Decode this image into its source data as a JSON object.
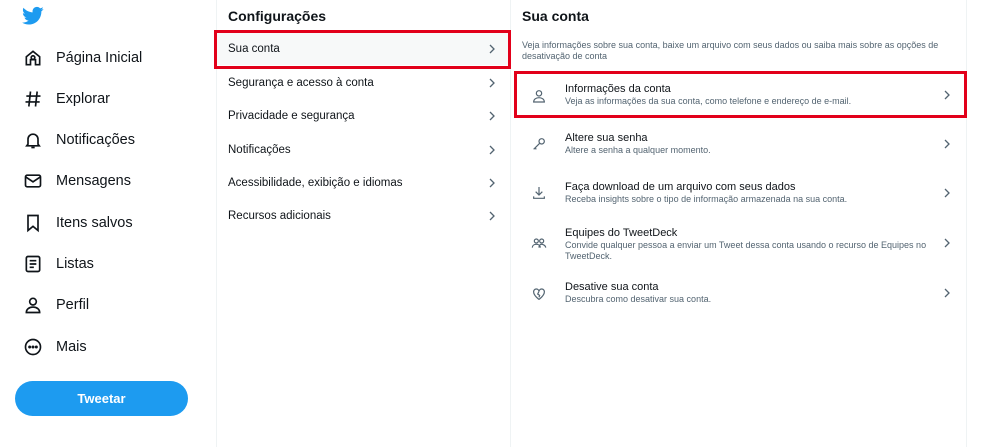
{
  "nav": {
    "items": [
      {
        "label": "Página Inicial",
        "icon": "home-icon"
      },
      {
        "label": "Explorar",
        "icon": "hashtag-icon"
      },
      {
        "label": "Notificações",
        "icon": "bell-icon"
      },
      {
        "label": "Mensagens",
        "icon": "mail-icon"
      },
      {
        "label": "Itens salvos",
        "icon": "bookmark-icon"
      },
      {
        "label": "Listas",
        "icon": "list-icon"
      },
      {
        "label": "Perfil",
        "icon": "person-icon"
      },
      {
        "label": "Mais",
        "icon": "more-icon"
      }
    ],
    "tweet_button": "Tweetar"
  },
  "settings": {
    "title": "Configurações",
    "items": [
      {
        "label": "Sua conta"
      },
      {
        "label": "Segurança e acesso à conta"
      },
      {
        "label": "Privacidade e segurança"
      },
      {
        "label": "Notificações"
      },
      {
        "label": "Acessibilidade, exibição e idiomas"
      },
      {
        "label": "Recursos adicionais"
      }
    ]
  },
  "account": {
    "title": "Sua conta",
    "description": "Veja informações sobre sua conta, baixe um arquivo com seus dados ou saiba mais sobre as opções de desativação de conta",
    "items": [
      {
        "title": "Informações da conta",
        "subtitle": "Veja as informações da sua conta, como telefone e endereço de e-mail.",
        "icon": "person-icon"
      },
      {
        "title": "Altere sua senha",
        "subtitle": "Altere a senha a qualquer momento.",
        "icon": "key-icon"
      },
      {
        "title": "Faça download de um arquivo com seus dados",
        "subtitle": "Receba insights sobre o tipo de informação armazenada na sua conta.",
        "icon": "download-icon"
      },
      {
        "title": "Equipes do TweetDeck",
        "subtitle": "Convide qualquer pessoa a enviar um Tweet dessa conta usando o recurso de Equipes no TweetDeck.",
        "icon": "people-icon"
      },
      {
        "title": "Desative sua conta",
        "subtitle": "Descubra como desativar sua conta.",
        "icon": "broken-heart-icon"
      }
    ]
  },
  "colors": {
    "brand": "#1d9bf0",
    "highlight": "#e2001a",
    "text": "#0f1419",
    "secondary_text": "#536471"
  }
}
